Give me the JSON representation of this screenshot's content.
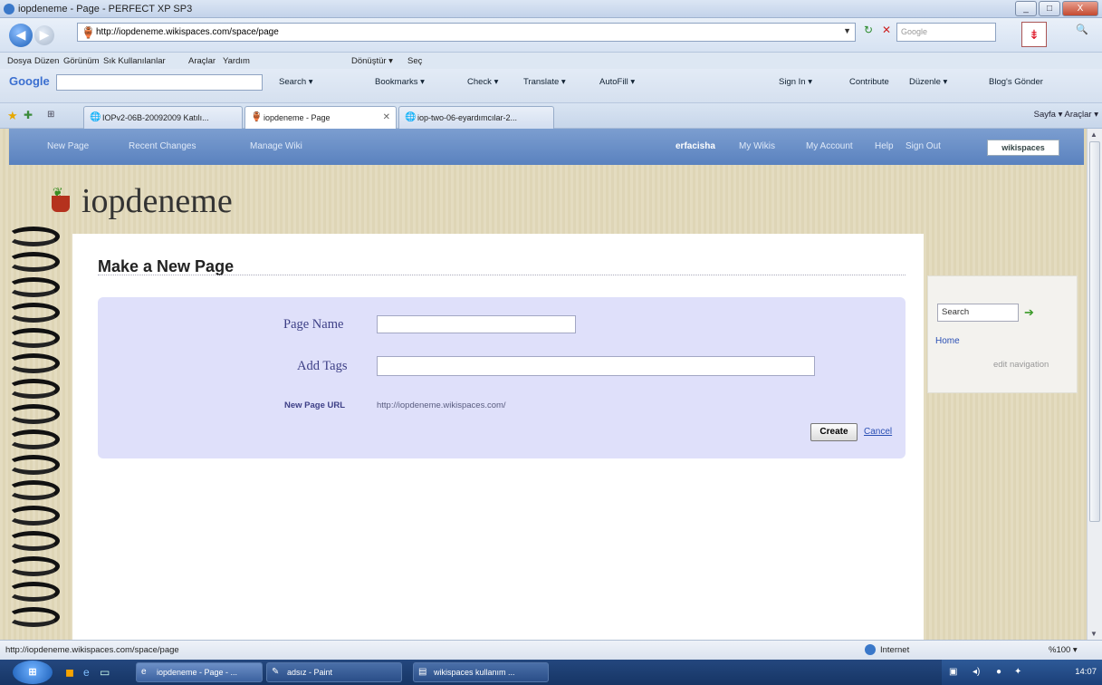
{
  "window": {
    "title": "iopdeneme - Page - PERFECT XP SP3",
    "controls": [
      "_",
      "□",
      "X"
    ]
  },
  "addressbar": {
    "back_icon": "◀",
    "forward_icon": "▶",
    "url": "http://iopdeneme.wikispaces.com/space/page",
    "dropdown_icon": "▼",
    "refresh_icon": "↻",
    "stop_icon": "✕",
    "search_placeholder": "Google",
    "addon_icon": "⇟",
    "search_go_icon": "🔍"
  },
  "menubar": [
    "Dosya",
    "Düzen",
    "Görünüm",
    "Sık Kullanılanlar",
    "Araçlar",
    "Yardım",
    "Dönüştür ▾",
    "Seç"
  ],
  "google_toolbar": {
    "logo": "Google",
    "items": [
      "Search ▾",
      "Bookmarks ▾",
      "Check ▾",
      "Translate ▾",
      "AutoFill ▾",
      "Sign In ▾",
      "Contribute",
      "Düzenle ▾",
      "Blog's Gönder"
    ]
  },
  "tabs": {
    "quick_tabs_icon": "⊞",
    "items": [
      {
        "label": "IOPv2-06B-20092009 Katılı...",
        "active": false
      },
      {
        "label": "iopdeneme - Page",
        "active": true
      },
      {
        "label": "iop-two-06-eyardımcılar-2...",
        "active": false
      }
    ],
    "close_icon": "✕",
    "command_bar": "Sayfa ▾   Araçlar ▾"
  },
  "wiki_nav": {
    "links": [
      "New Page",
      "Recent Changes",
      "Manage Wiki"
    ],
    "user": "erfacisha",
    "right_links": [
      "My Wikis",
      "My Account",
      "Help",
      "Sign Out"
    ],
    "brand": "wikispaces"
  },
  "site": {
    "title": "iopdeneme"
  },
  "page": {
    "heading": "Make a New Page",
    "page_name_label": "Page Name",
    "page_name_value": "",
    "add_tags_label": "Add Tags",
    "add_tags_value": "",
    "url_label": "New Page URL",
    "url_value": "http://iopdeneme.wikispaces.com/",
    "create_label": "Create",
    "cancel_label": "Cancel"
  },
  "sidebar": {
    "search_value": "Search",
    "go_icon": "➔",
    "home_link": "Home",
    "edit_navigation": "edit navigation"
  },
  "statusbar": {
    "url": "http://iopdeneme.wikispaces.com/space/page",
    "zone": "Internet",
    "zoom": "%100 ▾"
  },
  "taskbar": {
    "start_icon": "⊞",
    "tasks": [
      {
        "label": "iopdeneme - Page - ...",
        "active": true
      },
      {
        "label": "adsız - Paint",
        "active": false
      },
      {
        "label": "wikispaces kullanım ...",
        "active": false
      }
    ],
    "clock": "14:07"
  }
}
